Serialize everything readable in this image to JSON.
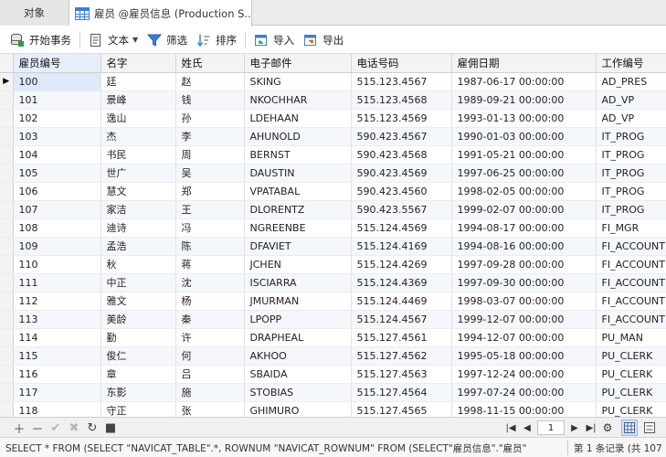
{
  "tabs": {
    "objects": "对象",
    "active": "雇员 @雇员信息 (Production S..."
  },
  "toolbar": {
    "begin_transaction": "开始事务",
    "text": "文本",
    "filter": "筛选",
    "sort": "排序",
    "import": "导入",
    "export": "导出"
  },
  "grid": {
    "columns": [
      "雇员编号",
      "名字",
      "姓氏",
      "电子邮件",
      "电话号码",
      "雇佣日期",
      "工作编号"
    ],
    "rows": [
      [
        "100",
        "廷",
        "赵",
        "SKING",
        "515.123.4567",
        "1987-06-17 00:00:00",
        "AD_PRES"
      ],
      [
        "101",
        "景峰",
        "钱",
        "NKOCHHAR",
        "515.123.4568",
        "1989-09-21 00:00:00",
        "AD_VP"
      ],
      [
        "102",
        "逸山",
        "孙",
        "LDEHAAN",
        "515.123.4569",
        "1993-01-13 00:00:00",
        "AD_VP"
      ],
      [
        "103",
        "杰",
        "李",
        "AHUNOLD",
        "590.423.4567",
        "1990-01-03 00:00:00",
        "IT_PROG"
      ],
      [
        "104",
        "书民",
        "周",
        "BERNST",
        "590.423.4568",
        "1991-05-21 00:00:00",
        "IT_PROG"
      ],
      [
        "105",
        "世广",
        "吴",
        "DAUSTIN",
        "590.423.4569",
        "1997-06-25 00:00:00",
        "IT_PROG"
      ],
      [
        "106",
        "慧文",
        "郑",
        "VPATABAL",
        "590.423.4560",
        "1998-02-05 00:00:00",
        "IT_PROG"
      ],
      [
        "107",
        "家洁",
        "王",
        "DLORENTZ",
        "590.423.5567",
        "1999-02-07 00:00:00",
        "IT_PROG"
      ],
      [
        "108",
        "迪诗",
        "冯",
        "NGREENBE",
        "515.124.4569",
        "1994-08-17 00:00:00",
        "FI_MGR"
      ],
      [
        "109",
        "孟浩",
        "陈",
        "DFAVIET",
        "515.124.4169",
        "1994-08-16 00:00:00",
        "FI_ACCOUNT"
      ],
      [
        "110",
        "秋",
        "蒋",
        "JCHEN",
        "515.124.4269",
        "1997-09-28 00:00:00",
        "FI_ACCOUNT"
      ],
      [
        "111",
        "中正",
        "沈",
        "ISCIARRA",
        "515.124.4369",
        "1997-09-30 00:00:00",
        "FI_ACCOUNT"
      ],
      [
        "112",
        "雅文",
        "杨",
        "JMURMAN",
        "515.124.4469",
        "1998-03-07 00:00:00",
        "FI_ACCOUNT"
      ],
      [
        "113",
        "美龄",
        "秦",
        "LPOPP",
        "515.124.4567",
        "1999-12-07 00:00:00",
        "FI_ACCOUNT"
      ],
      [
        "114",
        "勤",
        "许",
        "DRAPHEAL",
        "515.127.4561",
        "1994-12-07 00:00:00",
        "PU_MAN"
      ],
      [
        "115",
        "俊仁",
        "何",
        "AKHOO",
        "515.127.4562",
        "1995-05-18 00:00:00",
        "PU_CLERK"
      ],
      [
        "116",
        "章",
        "吕",
        "SBAIDA",
        "515.127.4563",
        "1997-12-24 00:00:00",
        "PU_CLERK"
      ],
      [
        "117",
        "东影",
        "施",
        "STOBIAS",
        "515.127.4564",
        "1997-07-24 00:00:00",
        "PU_CLERK"
      ],
      [
        "118",
        "守正",
        "张",
        "GHIMURO",
        "515.127.4565",
        "1998-11-15 00:00:00",
        "PU_CLERK"
      ]
    ]
  },
  "nav": {
    "page": "1"
  },
  "status": {
    "sql": "SELECT * FROM (SELECT \"NAVICAT_TABLE\".*, ROWNUM \"NAVICAT_ROWNUM\" FROM (SELECT\"雇员信息\".\"雇员\"",
    "record": "第 1 条记录 (共 107"
  },
  "colors": {
    "accent": "#2f6fd6",
    "selected_header": "#e6eefc",
    "current_cell": "#dfe9fb",
    "alt_row": "#f4f7fc"
  }
}
